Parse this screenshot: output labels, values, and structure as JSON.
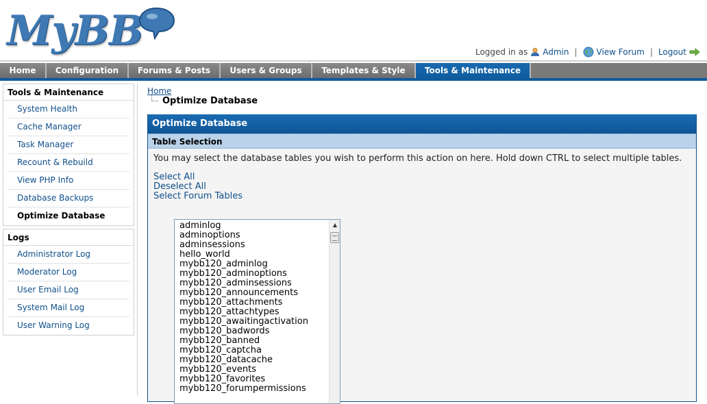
{
  "header": {
    "logo_text": "MyBB",
    "logged_in_as": "Logged in as",
    "admin_link": "Admin",
    "view_forum_link": "View Forum",
    "logout_link": "Logout",
    "separator": "|"
  },
  "nav": {
    "tabs": [
      {
        "label": "Home"
      },
      {
        "label": "Configuration"
      },
      {
        "label": "Forums & Posts"
      },
      {
        "label": "Users & Groups"
      },
      {
        "label": "Templates & Style"
      },
      {
        "label": "Tools & Maintenance"
      }
    ],
    "active_tab": "Tools & Maintenance"
  },
  "sidebar": {
    "sections": [
      {
        "title": "Tools & Maintenance",
        "items": [
          {
            "label": "System Health"
          },
          {
            "label": "Cache Manager"
          },
          {
            "label": "Task Manager"
          },
          {
            "label": "Recount & Rebuild"
          },
          {
            "label": "View PHP Info"
          },
          {
            "label": "Database Backups"
          },
          {
            "label": "Optimize Database"
          }
        ],
        "active_item": "Optimize Database"
      },
      {
        "title": "Logs",
        "items": [
          {
            "label": "Administrator Log"
          },
          {
            "label": "Moderator Log"
          },
          {
            "label": "User Email Log"
          },
          {
            "label": "System Mail Log"
          },
          {
            "label": "User Warning Log"
          }
        ]
      }
    ]
  },
  "breadcrumb": {
    "home": "Home",
    "current": "Optimize Database"
  },
  "panel": {
    "title": "Optimize Database",
    "subtitle": "Table Selection",
    "description": "You may select the database tables you wish to perform this action on here. Hold down CTRL to select multiple tables.",
    "links": {
      "select_all": "Select All",
      "deselect_all": "Deselect All",
      "select_forum_tables": "Select Forum Tables"
    },
    "tables": [
      "adminlog",
      "adminoptions",
      "adminsessions",
      "hello_world",
      "mybb120_adminlog",
      "mybb120_adminoptions",
      "mybb120_adminsessions",
      "mybb120_announcements",
      "mybb120_attachments",
      "mybb120_attachtypes",
      "mybb120_awaitingactivation",
      "mybb120_badwords",
      "mybb120_banned",
      "mybb120_captcha",
      "mybb120_datacache",
      "mybb120_events",
      "mybb120_favorites",
      "mybb120_forumpermissions"
    ]
  },
  "colors": {
    "nav_active": "#0f5c9f",
    "nav_inactive": "#7a7a7a",
    "link": "#0f4f8a",
    "panel_header": "#1b6cb3",
    "panel_subheader": "#bad2ea"
  }
}
